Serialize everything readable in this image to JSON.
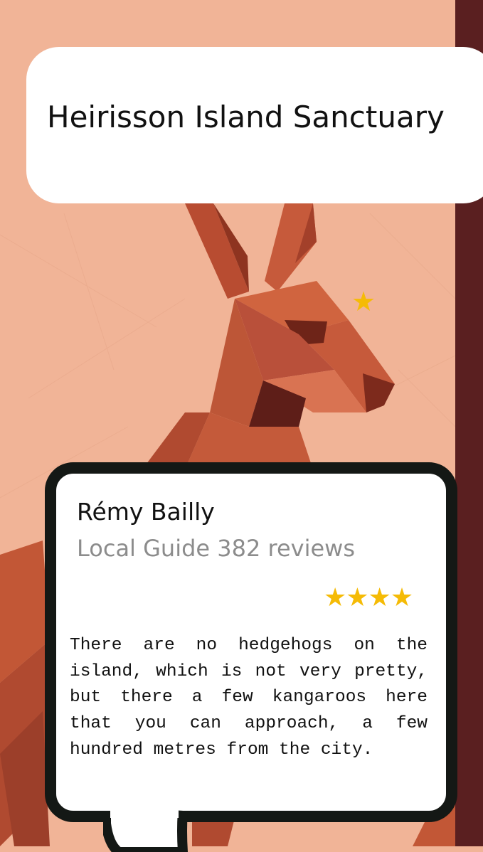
{
  "place": {
    "title": "Heirisson Island Sanctuary"
  },
  "review": {
    "author": "Rémy Bailly",
    "author_meta": "Local Guide 382 reviews",
    "rating": "★★★★",
    "rating_value": 4,
    "text": "There are no hedgehogs on the island, which is not very pretty, but there a few kangaroos here that you can approach, a few hundred metres from the city."
  },
  "decor": {
    "floating_star": "★"
  },
  "colors": {
    "background": "#f1b497",
    "side_bar": "#5a1f20",
    "kangaroo": "#c65a3b",
    "star": "#f5bb06",
    "bubble_border": "#141815"
  },
  "icons": {
    "rating": "star-icon",
    "illustration": "kangaroo-illustration"
  }
}
